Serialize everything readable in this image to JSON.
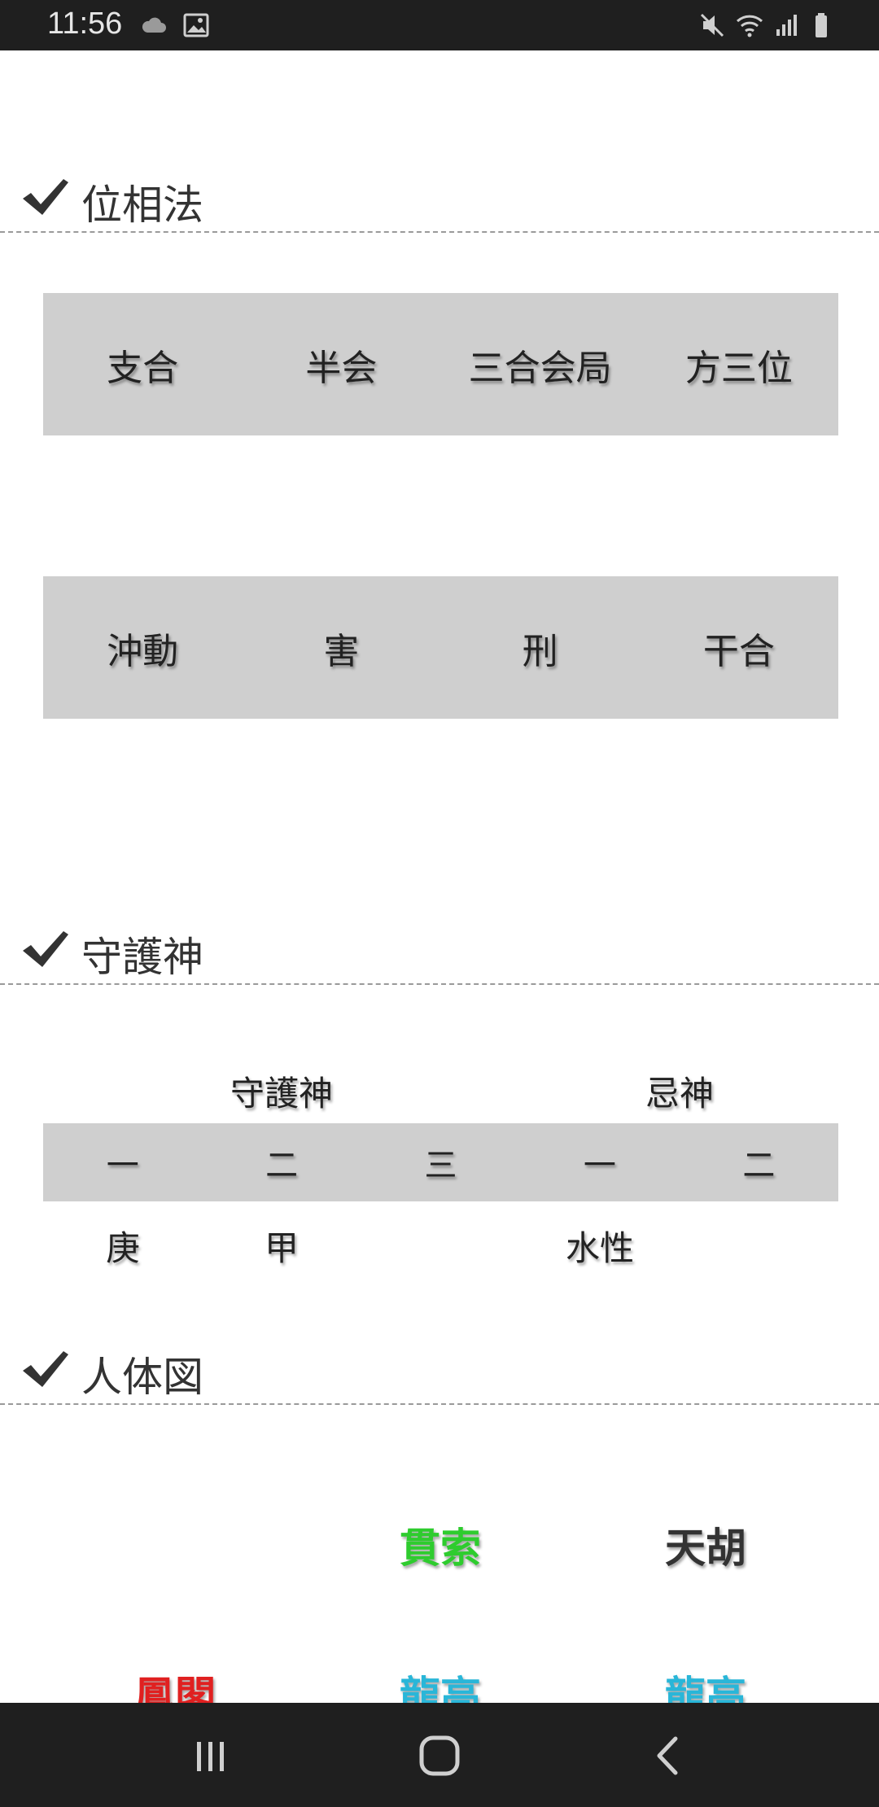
{
  "status_bar": {
    "time": "11:56",
    "left_icons": [
      "cloud-icon",
      "image-icon"
    ],
    "right_icons": [
      "mute-icon",
      "wifi-icon",
      "signal-icon",
      "battery-icon"
    ]
  },
  "sections": {
    "iso": {
      "title": "位相法",
      "row1": [
        "支合",
        "半会",
        "三合会局",
        "方三位"
      ],
      "row2": [
        "沖動",
        "害",
        "刑",
        "干合"
      ]
    },
    "guardian": {
      "title": "守護神",
      "group_labels": [
        "守護神",
        "忌神"
      ],
      "columns": [
        "一",
        "二",
        "三",
        "一",
        "二"
      ],
      "values": [
        "庚",
        "甲",
        "",
        "水性",
        ""
      ]
    },
    "body": {
      "title": "人体図",
      "row1": [
        {
          "text": "",
          "color": "#333333"
        },
        {
          "text": "貫索",
          "color": "#2ecc2e"
        },
        {
          "text": "天胡",
          "color": "#333333"
        }
      ],
      "row2": [
        {
          "text": "鳳閣",
          "color": "#e02020"
        },
        {
          "text": "龍高",
          "color": "#29b6d8"
        },
        {
          "text": "龍高",
          "color": "#29b6d8"
        }
      ]
    }
  },
  "nav_bar": {
    "buttons": [
      "recents-icon",
      "home-icon",
      "back-icon"
    ]
  }
}
